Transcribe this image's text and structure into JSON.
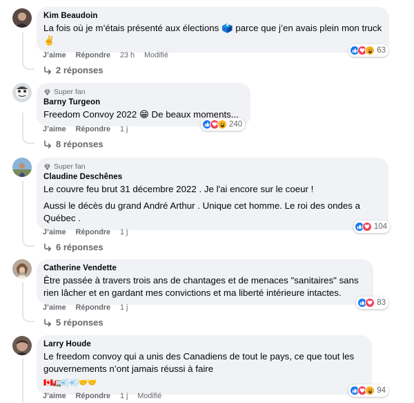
{
  "labels": {
    "like": "J’aime",
    "reply": "Répondre",
    "super_fan": "Super fan"
  },
  "colors": {
    "like_blue": "#1877f2",
    "love_red": "#f33e58",
    "haha_yellow": "#f7b125",
    "meta_text": "#65676b",
    "bubble_bg": "#f0f2f5"
  },
  "comments": [
    {
      "author": "Kim Beaudoin",
      "text": "La fois où je m’étais présenté aux élections 🗳️ parce que j’en avais plein mon truck ✌️",
      "time": "23 h",
      "edited": "Modifié",
      "reactions": [
        "like",
        "love",
        "haha"
      ],
      "reaction_count": "63",
      "replies": "2 réponses"
    },
    {
      "badge": "Super fan",
      "author": "Barny Turgeon",
      "text": "Freedom Convoy 2022 😁 De beaux moments...",
      "time": "1 j",
      "reactions": [
        "like",
        "love",
        "haha"
      ],
      "reaction_count": "240",
      "replies": "8 réponses"
    },
    {
      "badge": "Super fan",
      "author": "Claudine Deschênes",
      "text": "Le couvre feu brut 31 décembre 2022 . Je l'ai encore sur le coeur !",
      "text2": "Aussi le décès du grand André Arthur . Unique cet homme. Le roi des ondes a Québec .",
      "time": "1 j",
      "reactions": [
        "like",
        "love"
      ],
      "reaction_count": "104",
      "replies": "6 réponses"
    },
    {
      "author": "Catherine Vendette",
      "text": "Être passée à travers trois ans de chantages et de menaces \"sanitaires\" sans rien lâcher et en gardant mes convictions et ma liberté intérieure intactes.",
      "time": "1 j",
      "reactions": [
        "like",
        "love"
      ],
      "reaction_count": "83",
      "replies": "5 réponses"
    },
    {
      "author": "Larry Houde",
      "text": "Le freedom convoy qui a unis des Canadiens de tout le pays, ce que tout les gouvernements n’ont jamais réussi à faire",
      "emoji_line": "🇨🇦🚛💨💨🤝🤝",
      "time": "1 j",
      "edited": "Modifié",
      "reactions": [
        "like",
        "love",
        "haha"
      ],
      "reaction_count": "94"
    }
  ]
}
